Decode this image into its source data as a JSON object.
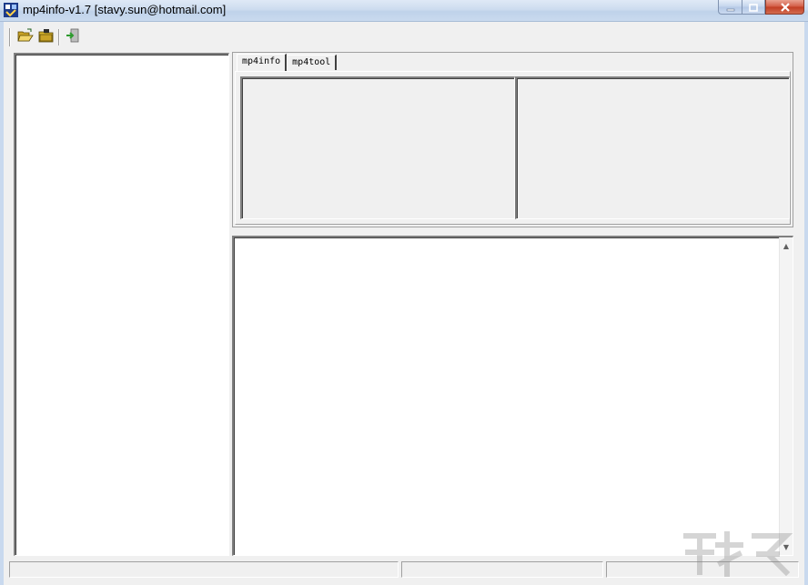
{
  "window": {
    "title": "mp4info-v1.7 [stavy.sun@hotmail.com]",
    "icons": {
      "app": "mp4-app-icon",
      "minimize": "minimize-icon",
      "maximize": "maximize-icon",
      "close": "close-icon"
    }
  },
  "toolbar": {
    "buttons": [
      {
        "name": "open-file",
        "icon": "open-folder-icon"
      },
      {
        "name": "open-folder",
        "icon": "closed-folder-icon"
      },
      {
        "name": "exit",
        "icon": "exit-icon"
      }
    ]
  },
  "tabs": [
    {
      "label": "mp4info",
      "active": true
    },
    {
      "label": "mp4tool",
      "active": false
    }
  ],
  "colors": {
    "window_bg": "#f0f0f0",
    "titlebar": "#cddcef",
    "close_button": "#c13d22"
  },
  "watermark": {
    "icon": "watermark-logo"
  }
}
